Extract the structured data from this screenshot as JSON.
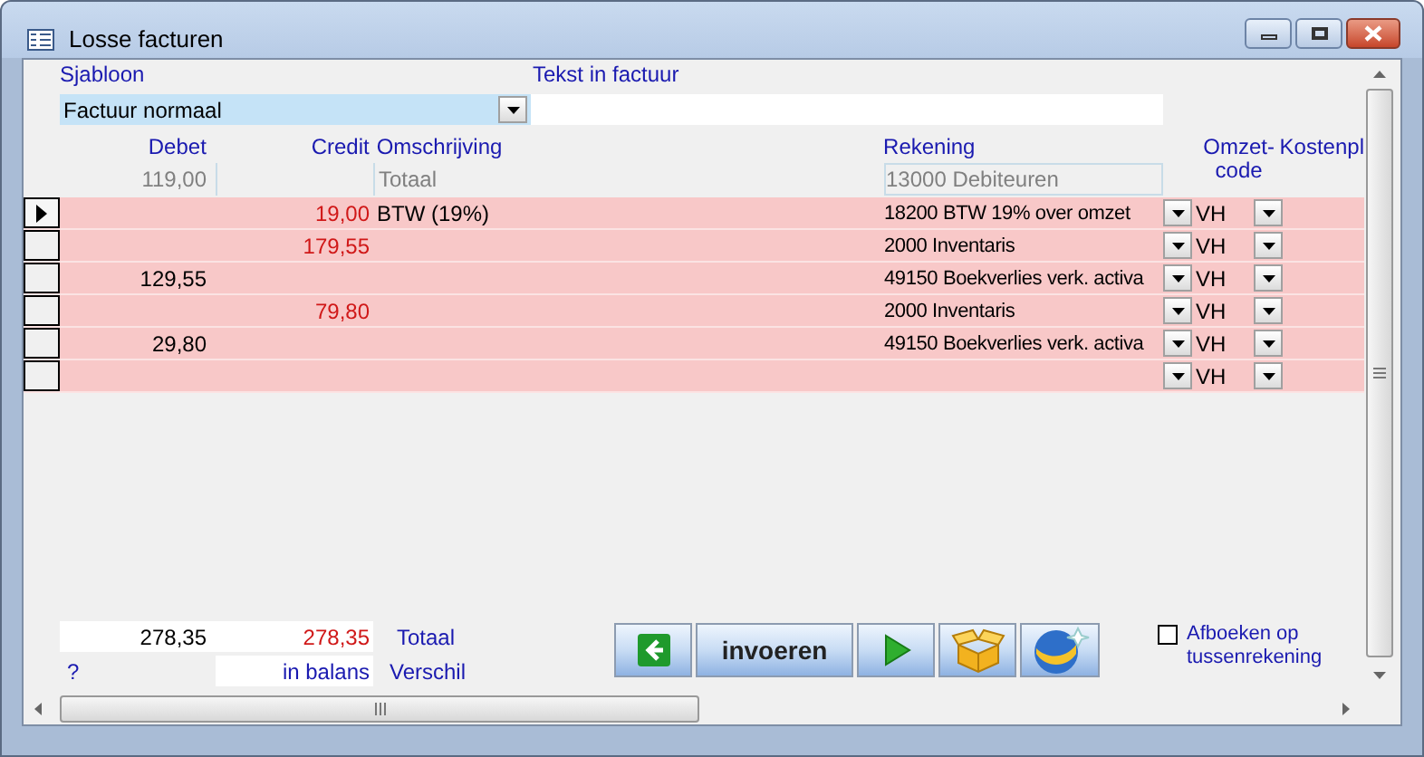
{
  "window": {
    "title": "Losse facturen"
  },
  "form": {
    "template_label": "Sjabloon",
    "template_value": "Factuur normaal",
    "text_label": "Tekst in factuur"
  },
  "columns": [
    {
      "label": "Debet"
    },
    {
      "label": "Credit"
    },
    {
      "label": "Omschrijving"
    },
    {
      "label": "Rekening"
    },
    {
      "label": "Omzet- code"
    },
    {
      "label": "Kostenpl"
    }
  ],
  "total_row": {
    "debet": "119,00",
    "omschrijving": "Totaal",
    "rekening": "13000  Debiteuren"
  },
  "rows": [
    {
      "selected": true,
      "debet": "",
      "credit": "19,00",
      "omschrijving": "BTW (19%)",
      "rekening": "18200  BTW 19% over omzet",
      "code": "VH"
    },
    {
      "selected": false,
      "debet": "",
      "credit": "179,55",
      "omschrijving": "",
      "rekening": "2000  Inventaris",
      "code": "VH"
    },
    {
      "selected": false,
      "debet": "129,55",
      "credit": "",
      "omschrijving": "",
      "rekening": "49150  Boekverlies verk. activa",
      "code": "VH"
    },
    {
      "selected": false,
      "debet": "",
      "credit": "79,80",
      "omschrijving": "",
      "rekening": "2000  Inventaris",
      "code": "VH"
    },
    {
      "selected": false,
      "debet": "29,80",
      "credit": "",
      "omschrijving": "",
      "rekening": "49150  Boekverlies verk. activa",
      "code": "VH"
    },
    {
      "selected": false,
      "debet": "",
      "credit": "",
      "omschrijving": "",
      "rekening": "",
      "code": "VH"
    }
  ],
  "footer": {
    "total_debet": "278,35",
    "total_credit": "278,35",
    "total_label": "Totaal",
    "balance_hint": "?",
    "balance_status": "in balans",
    "difference_label": "Verschil"
  },
  "buttons": [
    {
      "kind": "back"
    },
    {
      "kind": "text",
      "label": "invoeren"
    },
    {
      "kind": "play"
    },
    {
      "kind": "box"
    },
    {
      "kind": "globe"
    }
  ],
  "checkbox": {
    "label": "Afboeken op tussenrekening",
    "checked": false
  }
}
